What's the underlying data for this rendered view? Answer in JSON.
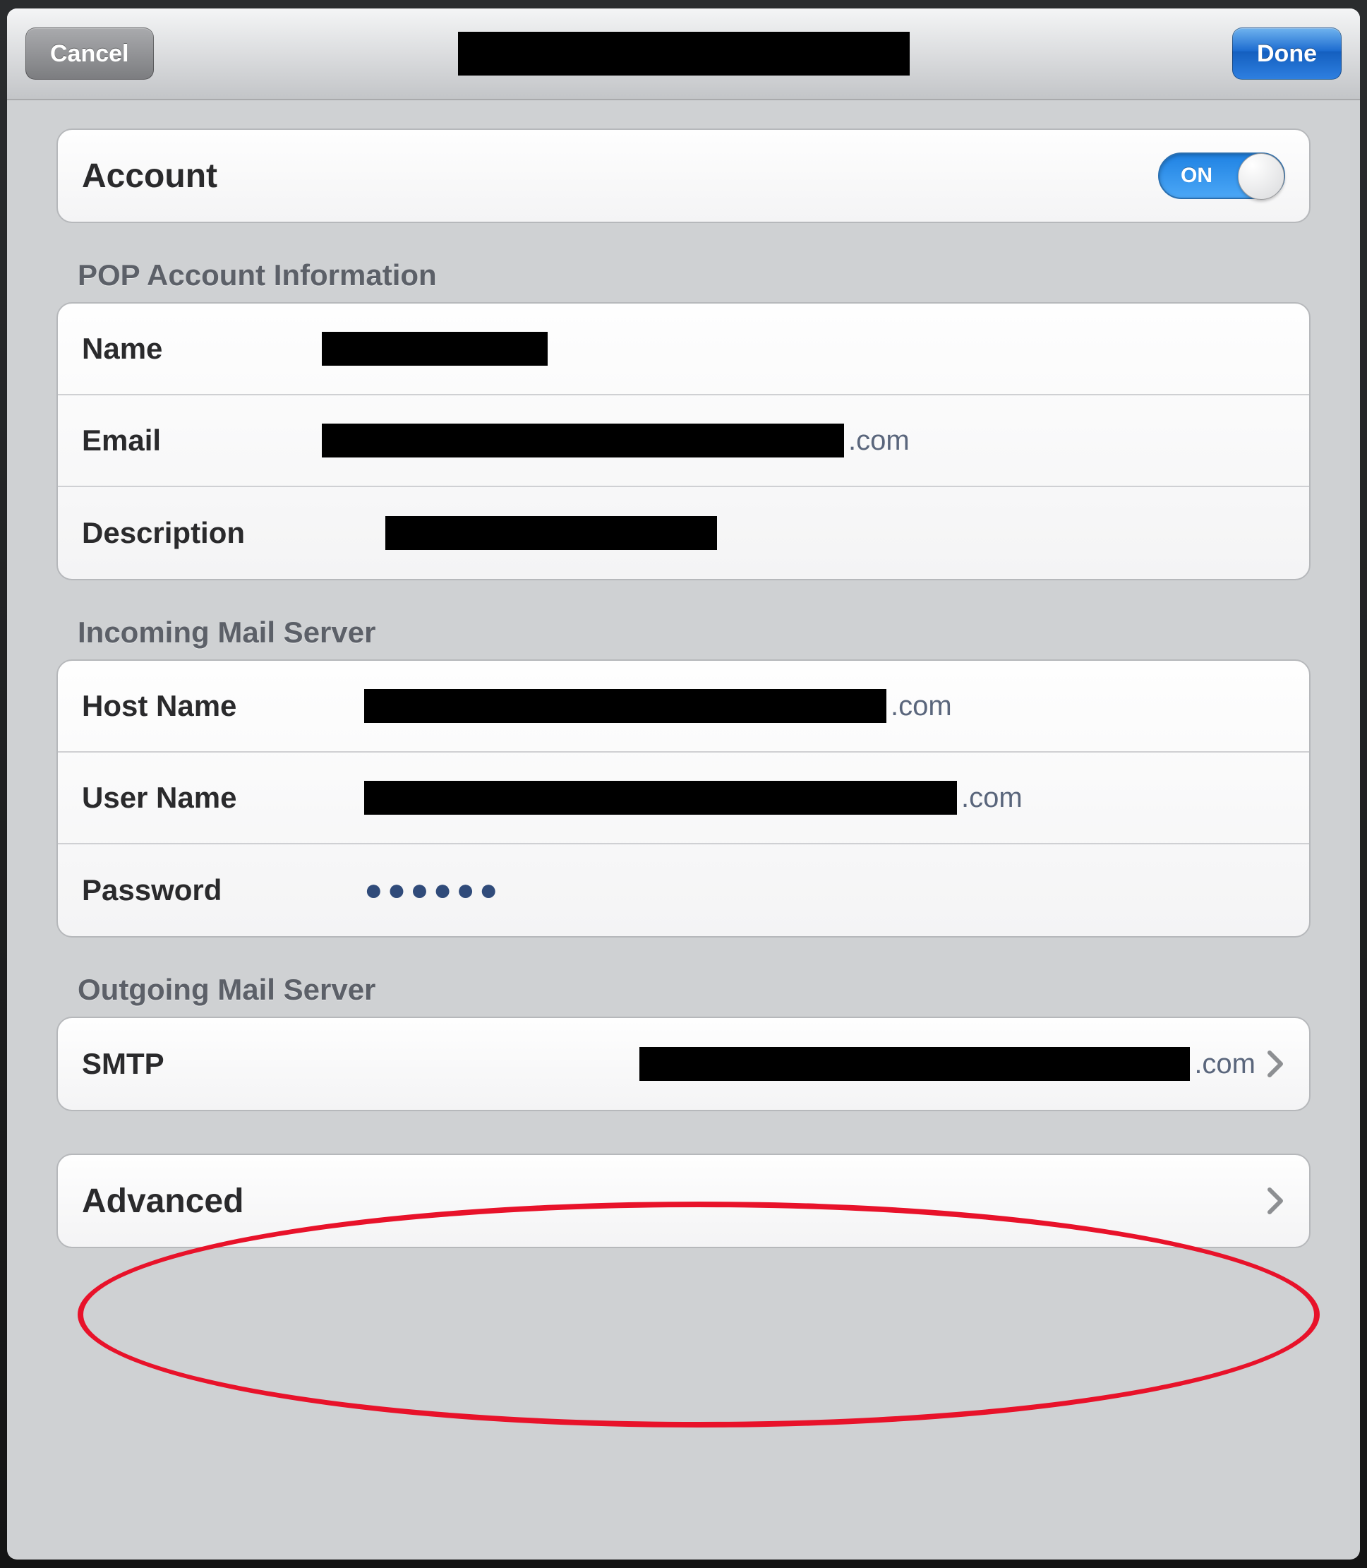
{
  "header": {
    "cancel": "Cancel",
    "done": "Done"
  },
  "account": {
    "label": "Account",
    "toggle_text": "ON",
    "toggle_on": true
  },
  "sections": {
    "pop_info_title": "POP Account Information",
    "incoming_title": "Incoming Mail Server",
    "outgoing_title": "Outgoing Mail Server"
  },
  "pop": {
    "name_label": "Name",
    "email_label": "Email",
    "email_visible_suffix": ".com",
    "description_label": "Description"
  },
  "incoming": {
    "host_label": "Host Name",
    "host_visible_suffix": ".com",
    "user_label": "User Name",
    "user_visible_suffix": ".com",
    "password_label": "Password",
    "password_masked": "●●●●●●"
  },
  "outgoing": {
    "smtp_label": "SMTP",
    "smtp_visible_suffix": ".com"
  },
  "advanced": {
    "label": "Advanced"
  }
}
